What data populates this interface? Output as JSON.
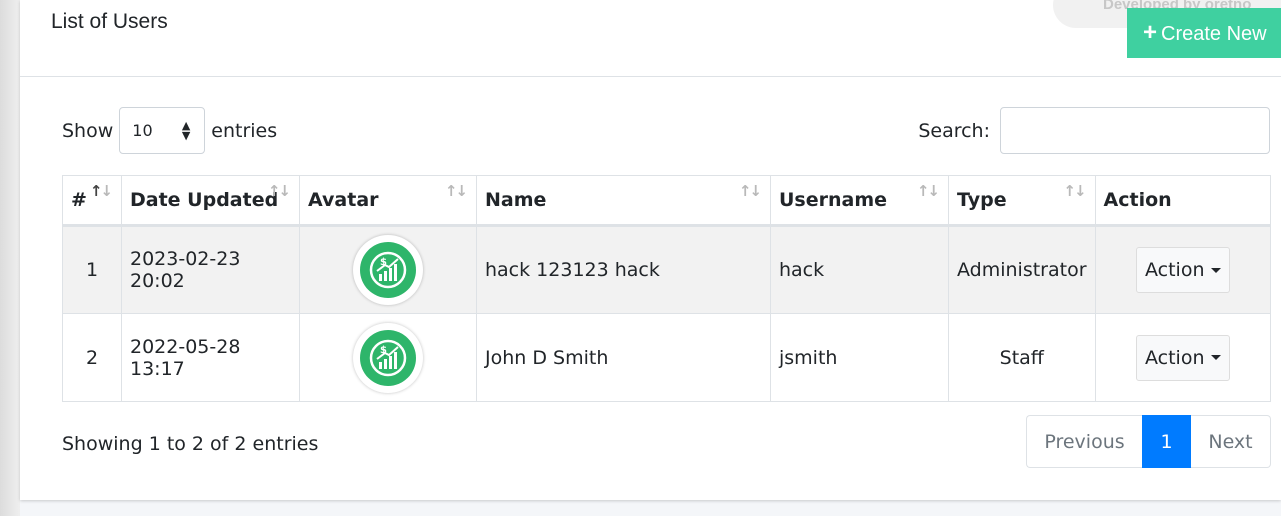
{
  "header": {
    "title": "List of Users",
    "developer_text": "Developed by oretno",
    "create_label": "Create New"
  },
  "controls": {
    "show_label": "Show",
    "entries_value": "10",
    "entries_label": "entries",
    "search_label": "Search:",
    "search_value": ""
  },
  "table": {
    "columns": [
      "#",
      "Date Updated",
      "Avatar",
      "Name",
      "Username",
      "Type",
      "Action"
    ],
    "rows": [
      {
        "num": "1",
        "date": "2023-02-23",
        "time": "20:02",
        "name": "hack 123123 hack",
        "username": "hack",
        "type": "Administrator",
        "action": "Action"
      },
      {
        "num": "2",
        "date": "2022-05-28",
        "time": "13:17",
        "name": "John D Smith",
        "username": "jsmith",
        "type": "Staff",
        "action": "Action"
      }
    ]
  },
  "footer": {
    "info": "Showing 1 to 2 of 2 entries",
    "previous": "Previous",
    "current_page": "1",
    "next": "Next"
  },
  "colors": {
    "accent": "#3fd0a0",
    "primary": "#007bff",
    "avatar_green": "#2eb56a"
  },
  "icons": {
    "create": "plus-icon",
    "avatar": "money-growth-chart-icon",
    "sort": "sort-arrows-icon"
  }
}
